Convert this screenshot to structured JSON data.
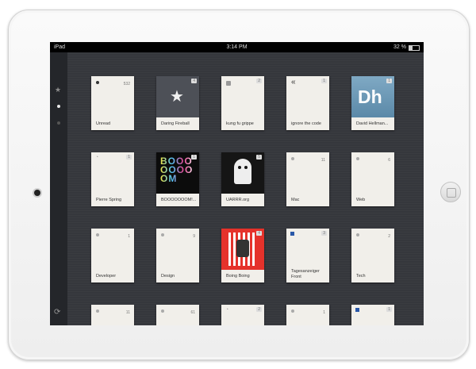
{
  "status_bar": {
    "carrier": "iPad",
    "time": "3:14 PM",
    "battery": "32 %",
    "battery_level": 0.32
  },
  "sidebar": {
    "items": [
      "starred-icon",
      "dot-icon",
      "dot-icon"
    ],
    "refresh": "refresh-icon"
  },
  "tiles": [
    {
      "label": "Unread",
      "count": "532"
    },
    {
      "label": "Daring Fireball",
      "badge": "4"
    },
    {
      "label": "kung fu grippe",
      "badge": "2"
    },
    {
      "label": "ignore the code",
      "badge": "1"
    },
    {
      "label": "David Hellman...",
      "badge": "1",
      "logo": "Dh"
    },
    {
      "label": "Pierre Spring",
      "badge": "1"
    },
    {
      "label": "BOOOOOOOM!...",
      "badge": "1",
      "logo": "BOOOOOOOOM"
    },
    {
      "label": "UARRR.org",
      "badge": "5"
    },
    {
      "label": "Mac",
      "count": "11"
    },
    {
      "label": "Web",
      "count": "6"
    },
    {
      "label": "Developer",
      "count": "1"
    },
    {
      "label": "Design",
      "count": "9"
    },
    {
      "label": "Boing Boing",
      "badge": "4"
    },
    {
      "label": "Tagesanzeiger Front",
      "badge": "3"
    },
    {
      "label": "Tech",
      "count": "2"
    },
    {
      "label": "",
      "count": "11"
    },
    {
      "label": "",
      "count": "61"
    },
    {
      "label": "",
      "badge": "2"
    },
    {
      "label": "",
      "count": "1"
    },
    {
      "label": "",
      "badge": "1"
    }
  ]
}
